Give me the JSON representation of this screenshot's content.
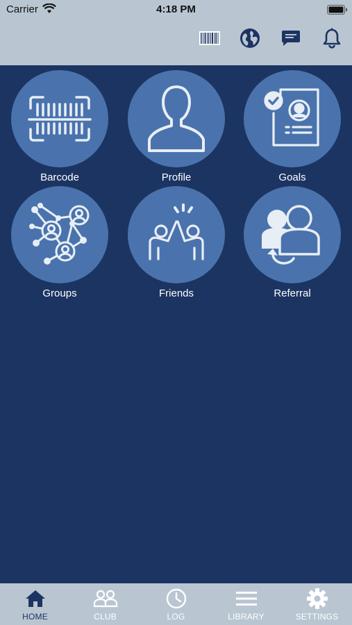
{
  "status_bar": {
    "carrier": "Carrier",
    "time": "4:18 PM"
  },
  "header": {
    "actions": [
      {
        "icon": "barcode-icon"
      },
      {
        "icon": "globe-icon"
      },
      {
        "icon": "chat-icon"
      },
      {
        "icon": "bell-icon"
      }
    ]
  },
  "grid": {
    "tiles": [
      {
        "label": "Barcode",
        "icon": "barcode-scan-icon"
      },
      {
        "label": "Profile",
        "icon": "profile-icon"
      },
      {
        "label": "Goals",
        "icon": "goals-icon"
      },
      {
        "label": "Groups",
        "icon": "groups-icon"
      },
      {
        "label": "Friends",
        "icon": "friends-icon"
      },
      {
        "label": "Referral",
        "icon": "referral-icon"
      }
    ]
  },
  "tabbar": {
    "tabs": [
      {
        "label": "HOME",
        "icon": "home-icon",
        "active": true
      },
      {
        "label": "CLUB",
        "icon": "club-icon",
        "active": false
      },
      {
        "label": "LOG",
        "icon": "clock-icon",
        "active": false
      },
      {
        "label": "LIBRARY",
        "icon": "menu-icon",
        "active": false
      },
      {
        "label": "SETTINGS",
        "icon": "gear-icon",
        "active": false
      }
    ]
  },
  "colors": {
    "background": "#1c3461",
    "header": "#b9c6d2",
    "tile": "#4a73ad",
    "icon_light": "#e8eef5",
    "active_tab": "#1c3461",
    "inactive_tab": "#ffffff"
  }
}
